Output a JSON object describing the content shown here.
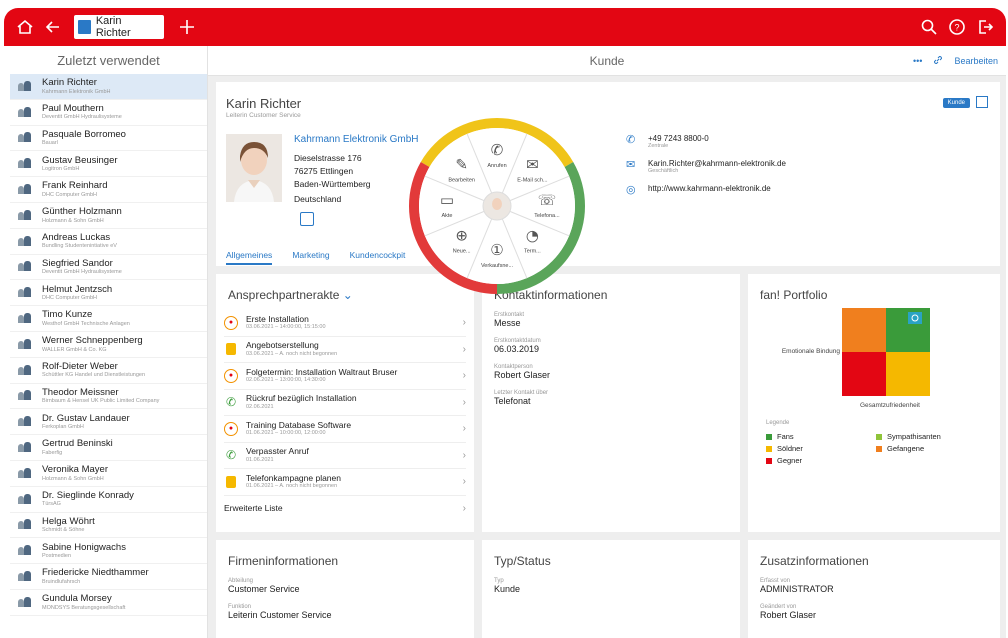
{
  "topbar": {
    "tab_label": "Karin Richter"
  },
  "sidebar": {
    "title": "Zuletzt verwendet",
    "items": [
      {
        "name": "Karin Richter",
        "company": "Kahrmann Elektronik GmbH",
        "active": true
      },
      {
        "name": "Paul Mouthern",
        "company": "Deventit GmbH Hydraulisysteme"
      },
      {
        "name": "Pasquale Borromeo",
        "company": "Bauarl"
      },
      {
        "name": "Gustav Beusinger",
        "company": "Logitron GmbH"
      },
      {
        "name": "Frank Reinhard",
        "company": "DHC Computer GmbH"
      },
      {
        "name": "Günther Holzmann",
        "company": "Holzmann & Sohn GmbH"
      },
      {
        "name": "Andreas Luckas",
        "company": "Bundling Studentenintiative eV"
      },
      {
        "name": "Siegfried Sandor",
        "company": "Deventit GmbH Hydraulisysteme"
      },
      {
        "name": "Helmut Jentzsch",
        "company": "DHC Computer GmbH"
      },
      {
        "name": "Timo Kunze",
        "company": "Westhof GmbH Technische Anlagen"
      },
      {
        "name": "Werner Schneppenberg",
        "company": "WALLER GmbH & Co. KG"
      },
      {
        "name": "Rolf-Dieter Weber",
        "company": "Schüttler KG Handel und Dienstleistungen"
      },
      {
        "name": "Theodor Meissner",
        "company": "Birnbaum & Hensel UK Public Limited Company"
      },
      {
        "name": "Dr. Gustav Landauer",
        "company": "Ferkoplan GmbH"
      },
      {
        "name": "Gertrud Beninski",
        "company": "Faberfig"
      },
      {
        "name": "Veronika Mayer",
        "company": "Holzmann & Sohn GmbH"
      },
      {
        "name": "Dr. Sieglinde Konrady",
        "company": "TürsAG"
      },
      {
        "name": "Helga Wöhrt",
        "company": "Schmidt & Söhne"
      },
      {
        "name": "Sabine Honigwachs",
        "company": "Postmedien"
      },
      {
        "name": "Friedericke Niedthammer",
        "company": "Bruindlufahrsch"
      },
      {
        "name": "Gundula Morsey",
        "company": "MONDSYS Beratungsgesellschaft"
      }
    ]
  },
  "main": {
    "title": "Kunde",
    "more_label": "•••",
    "edit_label": "Bearbeiten"
  },
  "head": {
    "name": "Karin Richter",
    "role": "Leiterin Customer Service",
    "badge": "Kunde",
    "company_link": "Kahrmann Elektronik GmbH",
    "street": "Dieselstrasse 176",
    "city": "76275 Ettlingen",
    "state": "Baden-Württemberg",
    "country": "Deutschland",
    "tabs": [
      "Allgemeines",
      "Marketing",
      "Kundencockpit"
    ],
    "phone": "+49 7243 8800-0",
    "phone_sub": "Zentrale",
    "email": "Karin.Richter@kahrmann-elektronik.de",
    "email_sub": "Geschäftlich",
    "web": "http://www.kahrmann-elektronik.de"
  },
  "radial": {
    "items": [
      "Anrufen",
      "E-Mail sch...",
      "Telefona...",
      "Term...",
      "Verkaufsne...",
      "Neue...",
      "Akte",
      "Bearbeiten"
    ],
    "colors": {
      "yellow": "#f0c419",
      "green": "#5aa55a",
      "red": "#e23a3a"
    }
  },
  "ansprech": {
    "title": "Ansprechpartnerakte",
    "chevron": "⌄",
    "rows": [
      {
        "icon": "orange",
        "title": "Erste Installation",
        "sub": "03.06.2021 – 14:00:00, 15:15:00"
      },
      {
        "icon": "yellow",
        "title": "Angebotserstellung",
        "sub": "03.06.2021 – A. noch nicht begonnen"
      },
      {
        "icon": "orange",
        "title": "Folgetermin: Installation Waltraut Bruser",
        "sub": "02.06.2021 – 13:00:00, 14:30:00"
      },
      {
        "icon": "green",
        "title": "Rückruf bezüglich Installation",
        "sub": "02.06.2021"
      },
      {
        "icon": "orange",
        "title": "Training Database Software",
        "sub": "01.06.2021 – 10:00:00, 12:00:00"
      },
      {
        "icon": "green",
        "title": "Verpasster Anruf",
        "sub": "01.06.2021"
      },
      {
        "icon": "yellow",
        "title": "Telefonkampagne planen",
        "sub": "01.06.2021 – A. noch nicht begonnen"
      }
    ],
    "more": "Erweiterte Liste"
  },
  "kontakt": {
    "title": "Kontaktinformationen",
    "fields": [
      {
        "label": "Erstkontakt",
        "value": "Messe"
      },
      {
        "label": "Erstkontaktdatum",
        "value": "06.03.2019"
      },
      {
        "label": "Kontaktperson",
        "value": "Robert Glaser"
      },
      {
        "label": "Letzter Kontakt über",
        "value": "Telefonat"
      }
    ]
  },
  "portfolio": {
    "title": "fan! Portfolio",
    "y_label": "Emotionale Bindung",
    "x_label": "Gesamtzufriedenheit",
    "legend_title": "Legende",
    "legend": [
      {
        "label": "Fans",
        "color": "#3a9b3a"
      },
      {
        "label": "Sympathisanten",
        "color": "#8fc43a"
      },
      {
        "label": "Söldner",
        "color": "#f5b800"
      },
      {
        "label": "Gefangene",
        "color": "#f07f1e"
      },
      {
        "label": "Gegner",
        "color": "#e30613"
      }
    ],
    "colors": {
      "orange": "#f07f1e",
      "green": "#3a9b3a",
      "red": "#e30613",
      "yellow": "#f5b800",
      "marker": "#2aa3c4"
    }
  },
  "firmen": {
    "title": "Firmeninformationen",
    "fields": [
      {
        "label": "Abteilung",
        "value": "Customer Service"
      },
      {
        "label": "Funktion",
        "value": "Leiterin Customer Service"
      }
    ]
  },
  "typ": {
    "title": "Typ/Status",
    "fields": [
      {
        "label": "Typ",
        "value": "Kunde"
      }
    ]
  },
  "zusatz": {
    "title": "Zusatzinformationen",
    "fields": [
      {
        "label": "Erfasst von",
        "value": "ADMINISTRATOR"
      },
      {
        "label": "Geändert von",
        "value": "Robert Glaser"
      }
    ]
  }
}
